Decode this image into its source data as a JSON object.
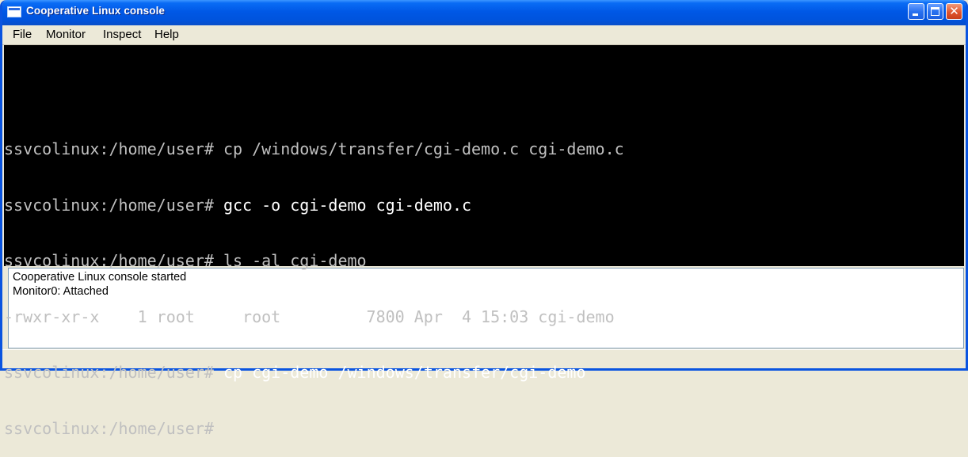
{
  "window": {
    "title": "Cooperative Linux console",
    "icon": "console-window-icon",
    "controls": {
      "minimize": "minimize-icon",
      "maximize": "maximize-icon",
      "close": "close-icon",
      "close_glyph": "✕"
    },
    "accent_color": "#0054E3",
    "close_color": "#E0552E"
  },
  "menu": {
    "items": [
      "File",
      "Monitor",
      "Inspect",
      "Help"
    ]
  },
  "terminal": {
    "background": "#000000",
    "foreground": "#C0C0C0",
    "lines": [
      {
        "prompt": "ssvcolinux:/home/user#",
        "command": "cp /windows/transfer/cgi-demo.c cgi-demo.c"
      },
      {
        "prompt": "ssvcolinux:/home/user#",
        "command": "gcc -o cgi-demo cgi-demo.c"
      },
      {
        "prompt": "ssvcolinux:/home/user#",
        "command": "ls -al cgi-demo"
      },
      {
        "prompt": "",
        "command": "-rwxr-xr-x    1 root     root         7800 Apr  4 15:03 cgi-demo"
      },
      {
        "prompt": "ssvcolinux:/home/user#",
        "command": "cp cgi-demo /windows/transfer/cgi-demo"
      },
      {
        "prompt": "ssvcolinux:/home/user#",
        "command": ""
      }
    ]
  },
  "log": {
    "lines": [
      "Cooperative Linux console started",
      "Monitor0: Attached"
    ]
  }
}
